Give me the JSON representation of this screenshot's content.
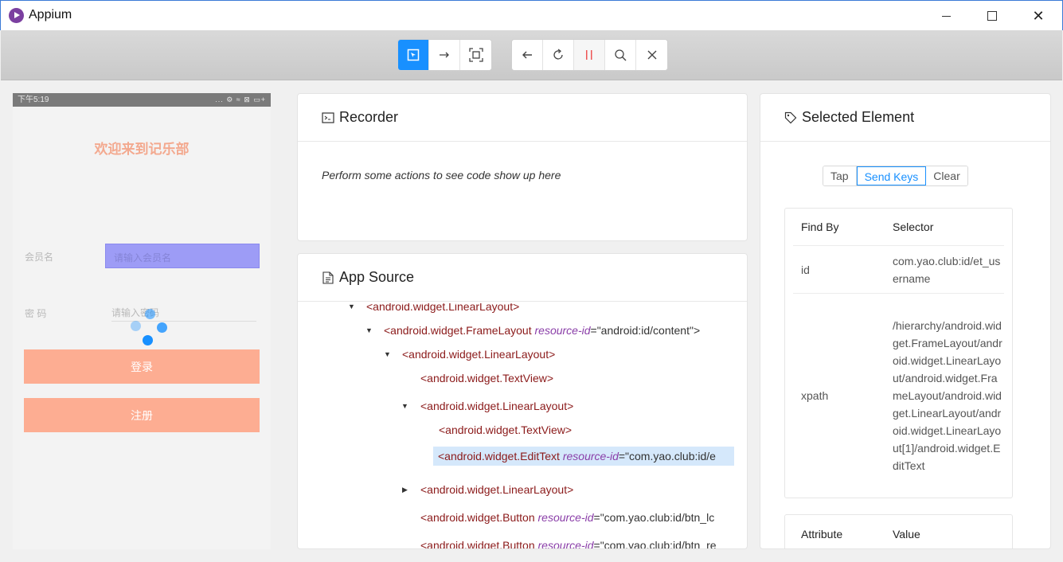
{
  "window": {
    "title": "Appium"
  },
  "toolbar": {
    "left_group": [
      "select-element",
      "swipe",
      "screenshot"
    ],
    "right_group": [
      "back",
      "refresh",
      "pause",
      "search",
      "close"
    ]
  },
  "phone": {
    "status_time": "下午5:19",
    "status_icons": "... ⚙ ≈ ⊠ ▭+",
    "welcome": "欢迎来到记乐部",
    "member_label": "会员名",
    "member_placeholder": "请输入会员名",
    "password_label": "密 码",
    "password_placeholder": "请输入密码",
    "login_btn": "登录",
    "register_btn": "注册"
  },
  "recorder": {
    "title": "Recorder",
    "message": "Perform some actions to see code show up here"
  },
  "source": {
    "title": "App Source",
    "nodes": [
      {
        "tag": "<android.widget.LinearLayout>"
      },
      {
        "tag": "<android.widget.FrameLayout",
        "attr": "resource-id",
        "val": "=\"android:id/content\">"
      },
      {
        "tag": "<android.widget.LinearLayout>"
      },
      {
        "tag": "<android.widget.TextView>"
      },
      {
        "tag": "<android.widget.LinearLayout>"
      },
      {
        "tag": "<android.widget.TextView>"
      },
      {
        "tag": "<android.widget.EditText",
        "attr": "resource-id",
        "val": "=\"com.yao.club:id/e"
      },
      {
        "tag": "<android.widget.LinearLayout>"
      },
      {
        "tag": "<android.widget.Button",
        "attr": "resource-id",
        "val": "=\"com.yao.club:id/btn_lc"
      },
      {
        "tag": "<android.widget.Button",
        "attr": "resource-id",
        "val": "=\"com.yao.club:id/btn_re"
      }
    ]
  },
  "selected": {
    "title": "Selected Element",
    "actions": [
      "Tap",
      "Send Keys",
      "Clear"
    ],
    "find_by_header": "Find By",
    "selector_header": "Selector",
    "rows": [
      {
        "by": "id",
        "selector": "com.yao.club:id/et_username"
      },
      {
        "by": "xpath",
        "selector": "/hierarchy/android.widget.FrameLayout/android.widget.LinearLayout/android.widget.FrameLayout/android.widget.LinearLayout/android.widget.LinearLayout[1]/android.widget.EditText"
      }
    ],
    "attribute_header": "Attribute",
    "value_header": "Value"
  },
  "colors": {
    "accent": "#1890ff",
    "phone_button": "#fdad92",
    "highlight_input": "#9d9cf6"
  }
}
